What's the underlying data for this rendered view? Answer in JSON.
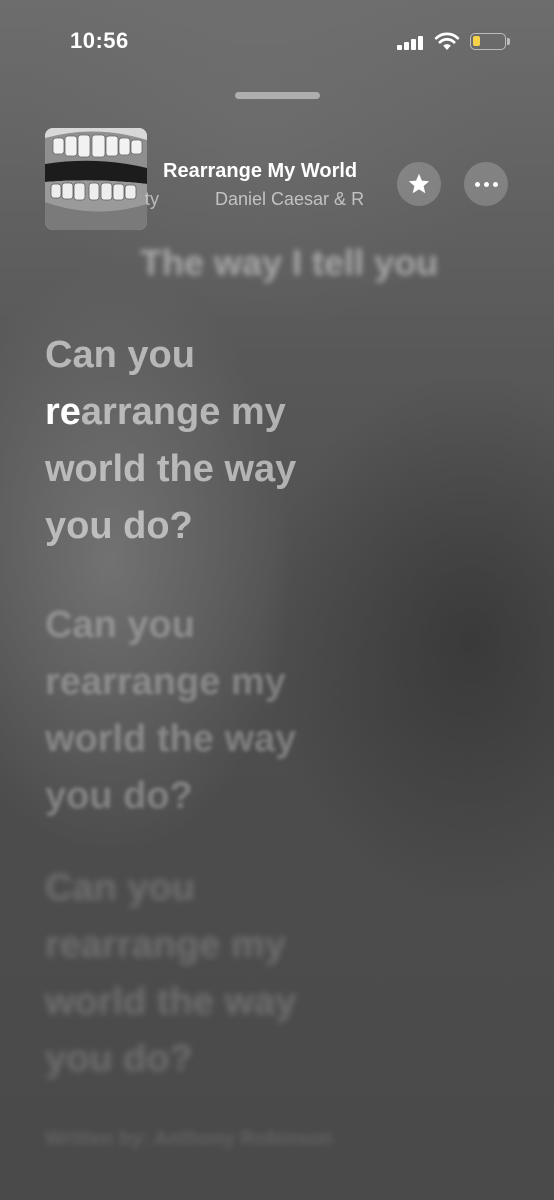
{
  "status_bar": {
    "time": "10:56",
    "battery_level": 0.25,
    "battery_color": "#f5d247"
  },
  "now_playing": {
    "title": "Rearrange My World",
    "artist_lead": "ty",
    "artist": "Daniel Caesar & R",
    "artwork_icon": "album-artwork-teeth-photo",
    "favorite_icon": "star-icon",
    "more_icon": "ellipsis-icon"
  },
  "lyrics": {
    "previous": "The way I tell you",
    "current": {
      "sung": "re",
      "lines": [
        "Can you",
        "arrange my",
        "world the way",
        "you do?"
      ]
    },
    "next": [
      "Can you",
      "rearrange my",
      "world the way",
      "you do?"
    ],
    "later": [
      "Can you",
      "rearrange my",
      "world the way",
      "you do?"
    ],
    "credits": "Written by: Anthony Robinson"
  }
}
